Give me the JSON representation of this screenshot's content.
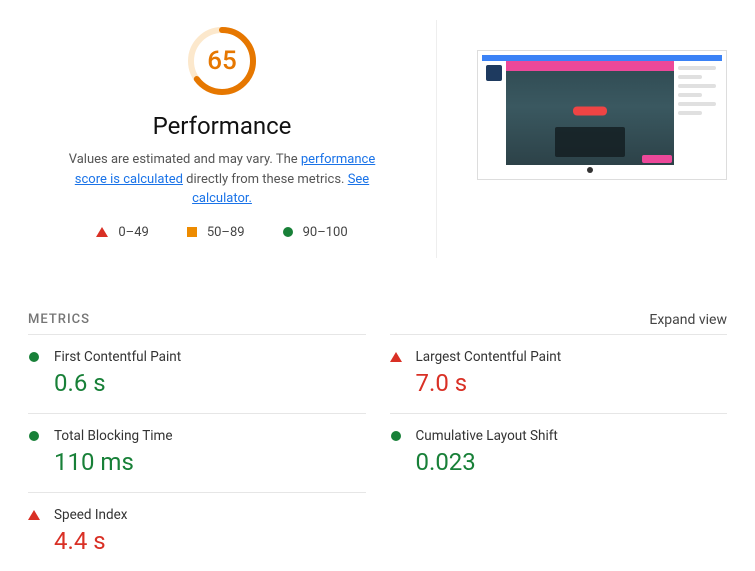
{
  "gauge": {
    "score": "65",
    "title": "Performance",
    "color": "#e67700",
    "percent": 65
  },
  "description": {
    "pre": "Values are estimated and may vary. The ",
    "link1": "performance score is calculated",
    "mid": " directly from these metrics. ",
    "link2": "See calculator."
  },
  "legend": {
    "fail": "0–49",
    "avg": "50–89",
    "pass": "90–100"
  },
  "metrics_header": {
    "label": "METRICS",
    "expand": "Expand view"
  },
  "metrics": [
    {
      "name": "First Contentful Paint",
      "value": "0.6 s",
      "status": "pass"
    },
    {
      "name": "Largest Contentful Paint",
      "value": "7.0 s",
      "status": "fail"
    },
    {
      "name": "Total Blocking Time",
      "value": "110 ms",
      "status": "pass"
    },
    {
      "name": "Cumulative Layout Shift",
      "value": "0.023",
      "status": "pass"
    },
    {
      "name": "Speed Index",
      "value": "4.4 s",
      "status": "fail"
    }
  ]
}
